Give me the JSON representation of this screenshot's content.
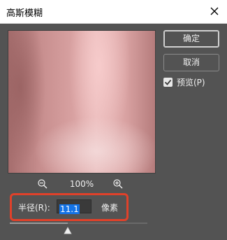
{
  "dialog": {
    "title": "高斯模糊",
    "ok_label": "确定",
    "cancel_label": "取消",
    "preview_label": "预览(P)",
    "preview_checked": true
  },
  "zoom": {
    "level": "100%"
  },
  "radius": {
    "label": "半径(R):",
    "value": "11.1",
    "unit": "像素",
    "slider_fraction": 0.42
  },
  "icons": {
    "close": "close-icon",
    "zoom_out": "zoom-out-icon",
    "zoom_in": "zoom-in-icon",
    "check": "checkmark-icon",
    "slider_thumb": "triangle-up-icon"
  },
  "colors": {
    "dialog_bg": "#535353",
    "highlight": "#e0412a",
    "selection": "#1473e6"
  }
}
